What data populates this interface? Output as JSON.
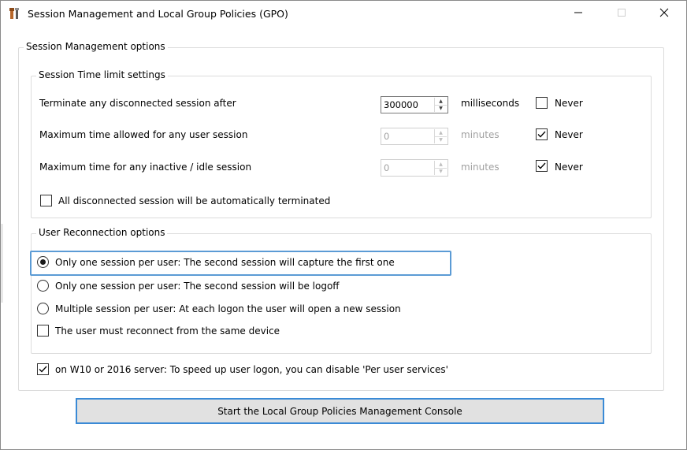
{
  "window": {
    "title": "Session Management and Local Group Policies (GPO)",
    "app_icon": "tools-icon",
    "minimize_icon": "minimize-icon",
    "maximize_icon": "maximize-icon",
    "close_icon": "close-icon"
  },
  "session_management": {
    "legend": "Session Management options",
    "time_limit": {
      "legend": "Session Time limit settings",
      "rows": [
        {
          "label": "Terminate any disconnected session after",
          "value": "300000",
          "unit": "milliseconds",
          "never_label": "Never",
          "never_checked": false,
          "enabled": true
        },
        {
          "label": "Maximum time allowed for any user session",
          "value": "0",
          "unit": "minutes",
          "never_label": "Never",
          "never_checked": true,
          "enabled": false
        },
        {
          "label": "Maximum time for any inactive / idle session",
          "value": "0",
          "unit": "minutes",
          "never_label": "Never",
          "never_checked": true,
          "enabled": false
        }
      ],
      "auto_terminate_label": "All disconnected session will be automatically terminated",
      "auto_terminate_checked": false
    },
    "reconnection": {
      "legend": "User Reconnection options",
      "options": [
        {
          "label": "Only one session per user: The second session will capture the first one",
          "selected": true
        },
        {
          "label": "Only one session per user: The second session will be logoff",
          "selected": false
        },
        {
          "label": "Multiple session per user: At each logon the user will open a new session",
          "selected": false
        }
      ],
      "same_device_label": "The user must reconnect from the same device",
      "same_device_checked": false
    },
    "per_user_services_label": "on W10 or 2016 server: To speed up user logon, you can disable 'Per user services'",
    "per_user_services_checked": true
  },
  "start_button_label": "Start the Local Group Policies Management Console",
  "colors": {
    "focus": "#5b9bd5",
    "button_border": "#3a8ad6",
    "button_bg": "#e1e1e1"
  }
}
